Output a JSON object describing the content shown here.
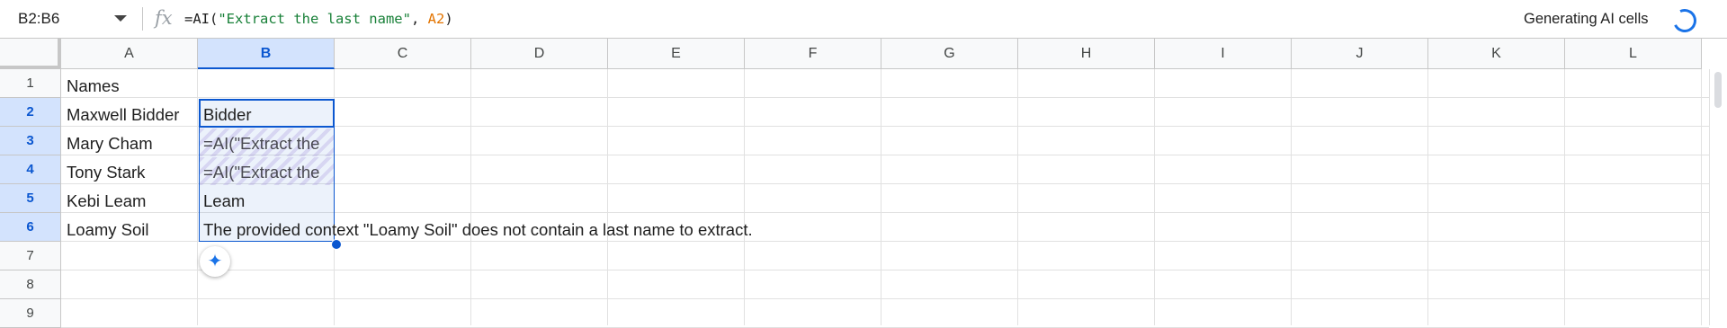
{
  "formula_bar": {
    "name_box": "B2:B6",
    "fx": "fx",
    "formula_prefix": "=AI(",
    "formula_string": "\"Extract the last name\"",
    "formula_sep": ", ",
    "formula_ref": "A2",
    "formula_suffix": ")",
    "status": "Generating AI cells"
  },
  "columns": [
    "A",
    "B",
    "C",
    "D",
    "E",
    "F",
    "G",
    "H",
    "I",
    "J",
    "K",
    "L"
  ],
  "selected_column": "B",
  "rows": [
    "1",
    "2",
    "3",
    "4",
    "5",
    "6",
    "7",
    "8",
    "9"
  ],
  "selected_rows": [
    "2",
    "3",
    "4",
    "5",
    "6"
  ],
  "cells": {
    "A1": "Names",
    "A2": "Maxwell Bidder",
    "A3": "Mary Cham",
    "A4": "Tony Stark",
    "A5": "Kebi Leam",
    "A6": "Loamy Soil",
    "B2": "Bidder",
    "B3": "=AI(\"Extract the",
    "B4": "=AI(\"Extract the",
    "B5": "Leam",
    "B6": "The provided context \"Loamy Soil\" does not contain a last name to extract."
  },
  "colors": {
    "selection_blue": "#0b57d0",
    "string_green": "#188038",
    "ref_orange": "#e37400",
    "header_bg": "#f8f9fa"
  },
  "icons": {
    "ai_chip": "sparkle-icon",
    "status": "spinner-icon"
  }
}
